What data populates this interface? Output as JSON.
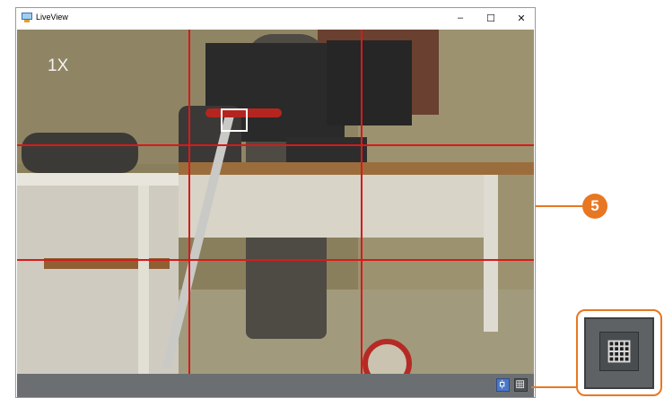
{
  "window": {
    "title": "LiveView"
  },
  "controls": {
    "minimize": "–",
    "maximize": "☐",
    "close": "✕"
  },
  "liveview": {
    "zoom": "1X"
  },
  "callout": {
    "number": "5"
  },
  "icons": {
    "app": "liveview-app-icon",
    "focus": "focus-area-icon",
    "grid": "grid-overlay-icon"
  },
  "colors": {
    "grid_lines": "#d81a1a",
    "callout": "#e87722",
    "toolbar": "#6b6f71",
    "focus_button": "#4a78c8"
  }
}
